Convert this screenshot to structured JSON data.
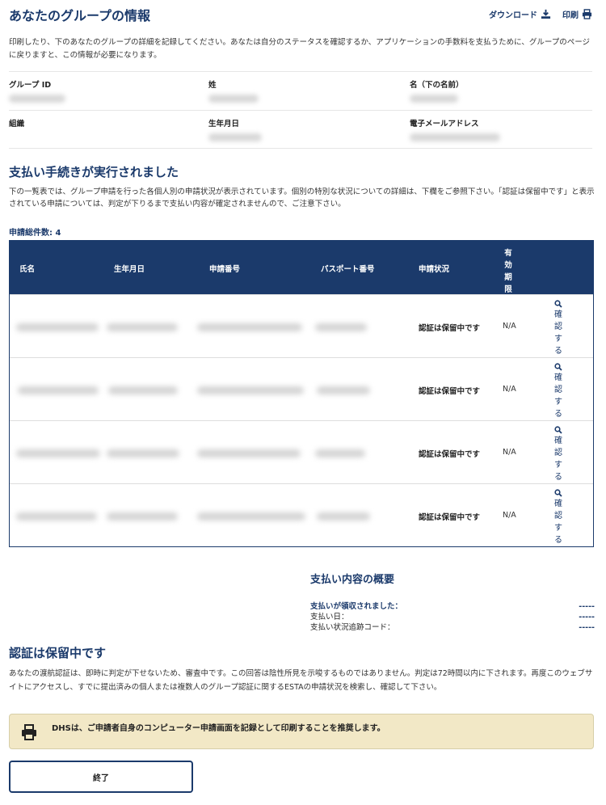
{
  "header": {
    "title": "あなたのグループの情報",
    "download_label": "ダウンロード",
    "print_label": "印刷"
  },
  "intro_text": "印刷したり、下のあなたのグループの詳細を記録してください。あなたは自分のステータスを確認するか、アプリケーションの手数料を支払うために、グループのページに戻りますと、この情報が必要になります。",
  "group_info": {
    "group_id_label": "グループ ID",
    "surname_label": "姓",
    "given_name_label": "名（下の名前）",
    "organization_label": "組織",
    "birth_date_label": "生年月日",
    "email_label": "電子メールアドレス"
  },
  "payment_section": {
    "title": "支払い手続きが実行されました",
    "description": "下の一覧表では、グループ申請を行った各個人別の申請状況が表示されています。個別の特別な状況についての詳細は、下欄をご参照下さい。「認証は保留中です」と表示されている申請については、判定が下りるまで支払い内容が確定されませんので、ご注意下さい。",
    "total_label": "申請総件数: 4"
  },
  "table": {
    "headers": {
      "name": "氏名",
      "birth_date": "生年月日",
      "application_number": "申請番号",
      "passport_number": "パスポート番号",
      "status": "申請状況",
      "expiry": "有効期限"
    },
    "rows": [
      {
        "status": "認証は保留中です",
        "expiry": "N/A",
        "action": "確認する"
      },
      {
        "status": "認証は保留中です",
        "expiry": "N/A",
        "action": "確認する"
      },
      {
        "status": "認証は保留中です",
        "expiry": "N/A",
        "action": "確認する"
      },
      {
        "status": "認証は保留中です",
        "expiry": "N/A",
        "action": "確認する"
      }
    ]
  },
  "summary": {
    "title": "支払い内容の概要",
    "received_label": "支払いが領収されました：",
    "received_value": "-----",
    "date_label": "支払い日：",
    "date_value": "-----",
    "tracking_label": "支払い状況追跡コード：",
    "tracking_value": "-----"
  },
  "pending": {
    "title": "認証は保留中です",
    "description": "あなたの渡航認証は、即時に判定が下せないため、審査中です。この回答は陰性所見を示唆するものではありません。判定は72時間以内に下されます。再度このウェブサイトにアクセスし、すでに提出済みの個人または複数人のグループ認証に関するESTAの申請状況を検索し、確認して下さい。"
  },
  "notice": {
    "text": "DHSは、ご申請者自身のコンピューター申請画面を記録として印刷することを推奨します。"
  },
  "close_button_label": "終了",
  "colors": {
    "primary": "#1b3a6b",
    "notice_bg": "#f2e8c6"
  },
  "icons": [
    "download-icon",
    "print-icon",
    "magnifier-icon",
    "printer-icon"
  ]
}
